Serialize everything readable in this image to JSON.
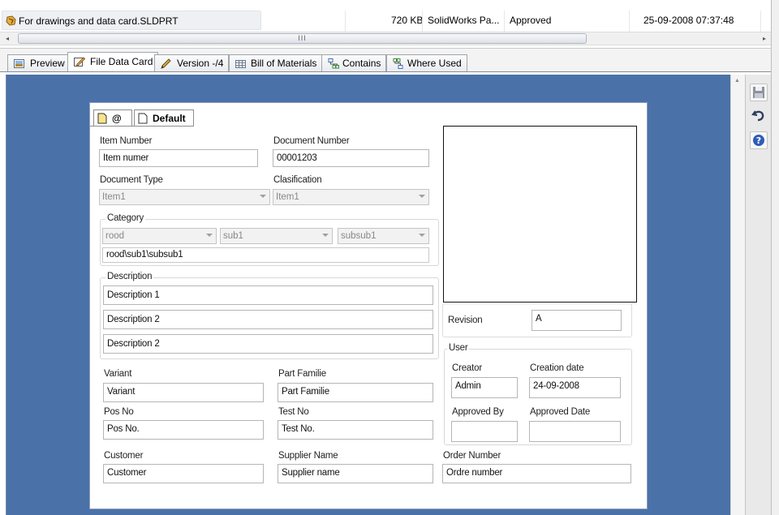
{
  "file_row": {
    "name": "For drawings and data card.SLDPRT",
    "size": "720 KB",
    "type": "SolidWorks Pa...",
    "state": "Approved",
    "date": "25-09-2008 07:37:48"
  },
  "scrollbar": {
    "left_arrow": "◂",
    "right_arrow": "▸",
    "thumb_grip": "III"
  },
  "tabs": [
    {
      "label": "Preview"
    },
    {
      "label": "File Data Card"
    },
    {
      "label": "Version -/4"
    },
    {
      "label": "Bill of Materials"
    },
    {
      "label": "Contains"
    },
    {
      "label": "Where Used"
    }
  ],
  "card": {
    "inner_tabs": {
      "at_label": "@",
      "default_label": "Default"
    },
    "item_number": {
      "label": "Item Number",
      "value": "Item numer"
    },
    "document_number": {
      "label": "Document Number",
      "value": "00001203"
    },
    "document_type": {
      "label": "Document Type",
      "value": "Item1"
    },
    "clasification": {
      "label": "Clasification",
      "value": "Item1"
    },
    "category": {
      "label": "Category",
      "level1": "rood",
      "level2": "sub1",
      "level3": "subsub1",
      "path": "rood\\sub1\\subsub1"
    },
    "description": {
      "label": "Description",
      "lines": [
        "Description 1",
        "Description 2",
        "Description 2"
      ]
    },
    "revision": {
      "label": "Revision",
      "value": "A"
    },
    "user": {
      "label": "User",
      "creator_label": "Creator",
      "creator": "Admin",
      "creation_date_label": "Creation date",
      "creation_date": "24-09-2008",
      "approved_by_label": "Approved By",
      "approved_by": "",
      "approved_date_label": "Approved Date",
      "approved_date": ""
    },
    "variant": {
      "label": "Variant",
      "value": "Variant"
    },
    "part_familie": {
      "label": "Part Familie",
      "value": "Part Familie"
    },
    "pos_no": {
      "label": "Pos No",
      "value": "Pos No."
    },
    "test_no": {
      "label": "Test No",
      "value": "Test No."
    },
    "customer": {
      "label": "Customer",
      "value": "Customer"
    },
    "supplier_name": {
      "label": "Supplier Name",
      "value": "Supplier name"
    },
    "order_number": {
      "label": "Order Number",
      "value": "Ordre number"
    }
  },
  "colors": {
    "workspace_bg": "#4a72a9",
    "card_border": "#8ba0c1"
  }
}
